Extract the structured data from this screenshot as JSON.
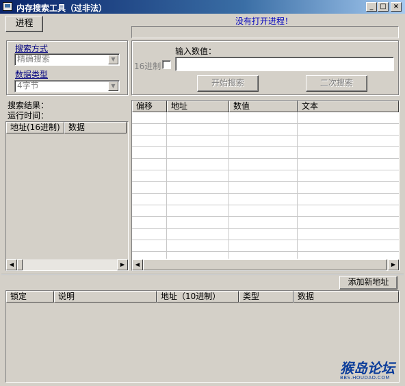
{
  "window": {
    "title": "内存搜索工具（过非法）",
    "minimize": "_",
    "maximize": "□",
    "close": "×"
  },
  "toolbar": {
    "process_button": "进程",
    "status_text": "没有打开进程！"
  },
  "search_options": {
    "method_label": "搜索方式",
    "method_value": "精确搜索",
    "type_label": "数据类型",
    "type_value": "4字节"
  },
  "search_input": {
    "prompt": "输入数值：",
    "hex_label": "16进制",
    "value": "",
    "start_button": "开始搜索",
    "second_button": "二次搜索"
  },
  "results_info": {
    "result_label": "搜索结果：",
    "runtime_label": "运行时间："
  },
  "left_list": {
    "columns": [
      "地址(16进制)",
      "数据"
    ]
  },
  "right_list": {
    "columns": [
      "偏移",
      "地址",
      "数值",
      "文本"
    ]
  },
  "address_list": {
    "add_button": "添加新地址",
    "columns": [
      "锁定",
      "说明",
      "地址（10进制）",
      "类型",
      "数据"
    ]
  },
  "watermark": {
    "main": "猴岛论坛",
    "sub": "BBS.HOUDAO.COM"
  },
  "colors": {
    "window_bg": "#d4d0c8",
    "title_start": "#0a246a",
    "title_end": "#a6caf0",
    "status_text": "#0000c0",
    "link_label": "#000080"
  }
}
